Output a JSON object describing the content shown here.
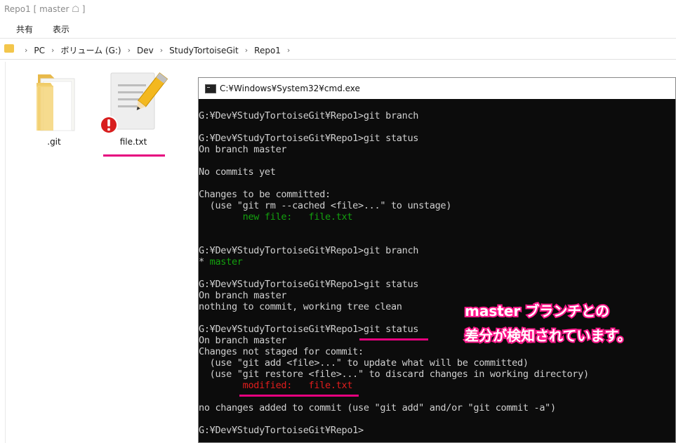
{
  "window": {
    "title": "Repo1 [ master ☖ ]"
  },
  "ribbon": {
    "tabs": [
      "共有",
      "表示"
    ]
  },
  "address": {
    "crumbs": [
      "PC",
      "ボリューム (G:)",
      "Dev",
      "StudyTortoiseGit",
      "Repo1"
    ]
  },
  "files": [
    {
      "name": ".git",
      "icon": "folder-icon"
    },
    {
      "name": "file.txt",
      "icon": "text-file-modified-icon"
    }
  ],
  "cmd": {
    "title": "C:¥Windows¥System32¥cmd.exe",
    "lines": [
      {
        "text": "G:¥Dev¥StudyTortoiseGit¥Repo1>git branch",
        "color": "default"
      },
      {
        "text": "",
        "color": "default"
      },
      {
        "text": "G:¥Dev¥StudyTortoiseGit¥Repo1>git status",
        "color": "default"
      },
      {
        "text": "On branch master",
        "color": "default"
      },
      {
        "text": "",
        "color": "default"
      },
      {
        "text": "No commits yet",
        "color": "default"
      },
      {
        "text": "",
        "color": "default"
      },
      {
        "text": "Changes to be committed:",
        "color": "default"
      },
      {
        "text": "  (use \"git rm --cached <file>...\" to unstage)",
        "color": "default"
      },
      {
        "text": "        new file:   file.txt",
        "color": "green"
      },
      {
        "text": "",
        "color": "default"
      },
      {
        "text": "",
        "color": "default"
      },
      {
        "text": "G:¥Dev¥StudyTortoiseGit¥Repo1>git branch",
        "color": "default"
      },
      {
        "text": "* master",
        "color": "green-star"
      },
      {
        "text": "",
        "color": "default"
      },
      {
        "text": "G:¥Dev¥StudyTortoiseGit¥Repo1>git status",
        "color": "default"
      },
      {
        "text": "On branch master",
        "color": "default"
      },
      {
        "text": "nothing to commit, working tree clean",
        "color": "default"
      },
      {
        "text": "",
        "color": "default"
      },
      {
        "text": "G:¥Dev¥StudyTortoiseGit¥Repo1>git status",
        "color": "default"
      },
      {
        "text": "On branch master",
        "color": "default"
      },
      {
        "text": "Changes not staged for commit:",
        "color": "default"
      },
      {
        "text": "  (use \"git add <file>...\" to update what will be committed)",
        "color": "default"
      },
      {
        "text": "  (use \"git restore <file>...\" to discard changes in working directory)",
        "color": "default"
      },
      {
        "text": "        modified:   file.txt",
        "color": "red"
      },
      {
        "text": "",
        "color": "default"
      },
      {
        "text": "no changes added to commit (use \"git add\" and/or \"git commit -a\")",
        "color": "default"
      },
      {
        "text": "",
        "color": "default"
      },
      {
        "text": "G:¥Dev¥StudyTortoiseGit¥Repo1>",
        "color": "default"
      }
    ]
  },
  "annotation": {
    "line1": "master ブランチとの",
    "line2": "差分が検知されています。"
  },
  "colors": {
    "highlight": "#e6007e",
    "term_green": "#13a10e",
    "term_red": "#e31d1d"
  }
}
